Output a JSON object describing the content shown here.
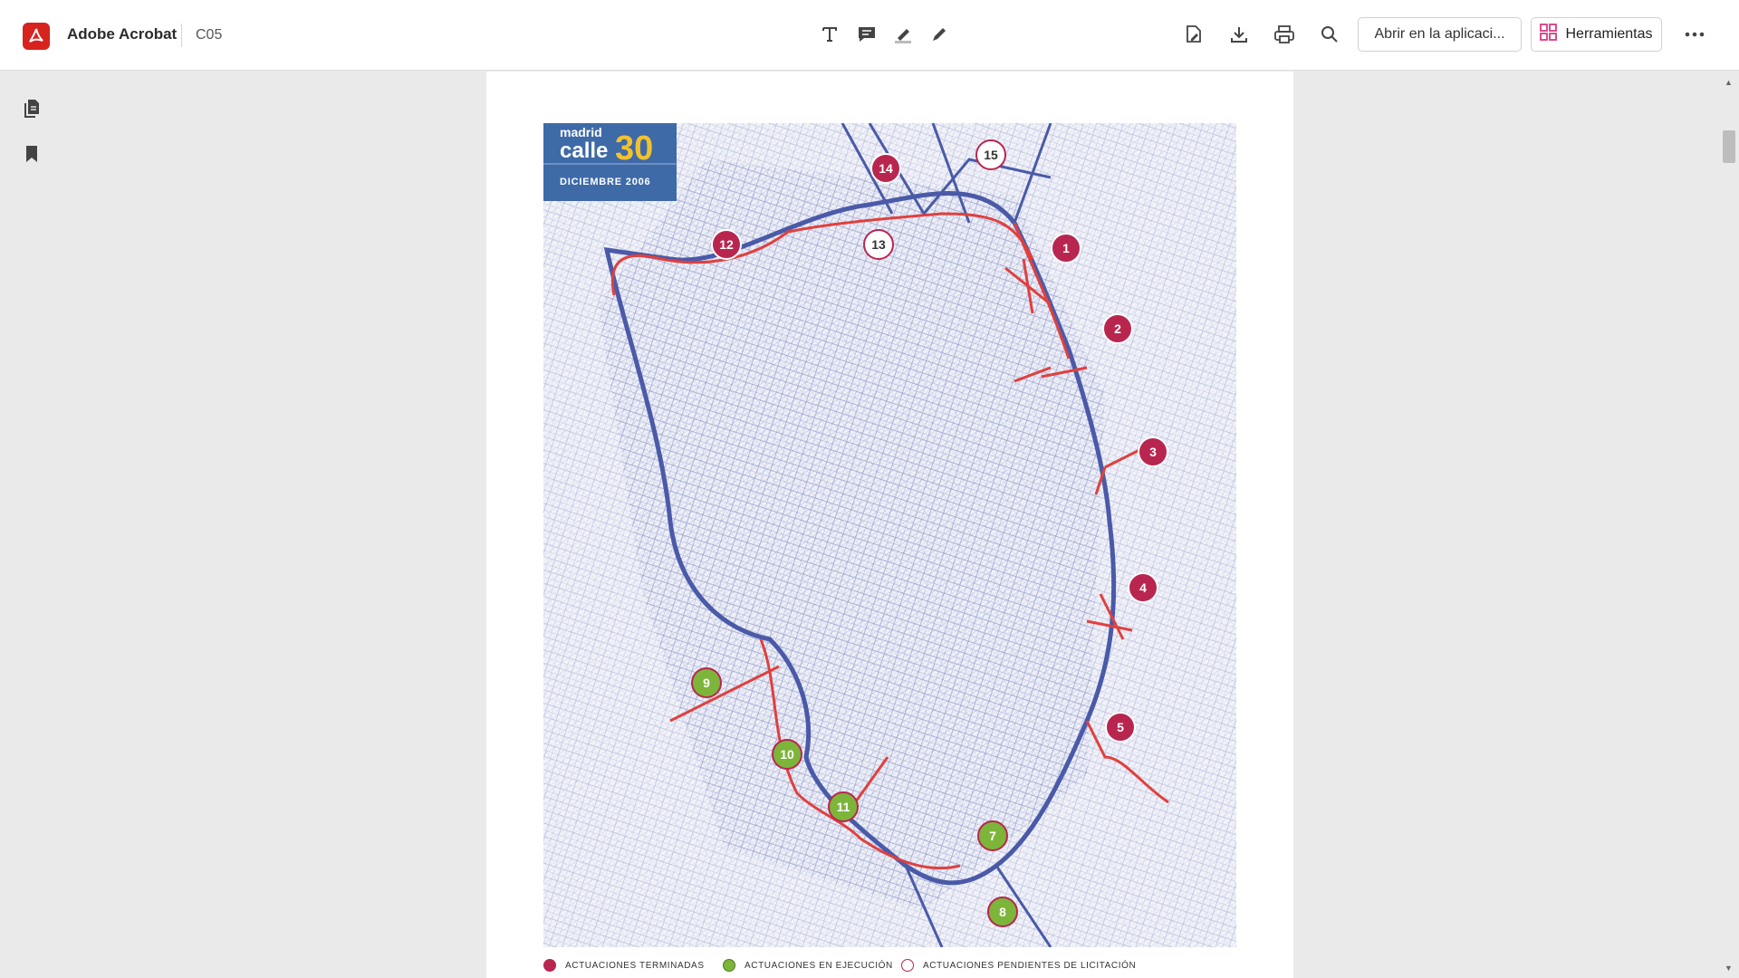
{
  "app": {
    "name": "Adobe Acrobat",
    "document": "C05"
  },
  "toolbar": {
    "tools": [
      "text-tool-icon",
      "comment-icon",
      "highlight-icon",
      "draw-icon"
    ],
    "open_in_app": "Abrir en la aplicaci...",
    "tools_label": "Herramientas"
  },
  "sidebar": {
    "items": [
      "pages-icon",
      "bookmark-icon"
    ]
  },
  "map": {
    "brand_top": "madrid",
    "brand_bottom": "calle",
    "brand_number": "30",
    "date": "DICIEMBRE 2006",
    "markers": [
      {
        "label": "1",
        "status": "terminada"
      },
      {
        "label": "2",
        "status": "terminada"
      },
      {
        "label": "3",
        "status": "terminada"
      },
      {
        "label": "4",
        "status": "terminada"
      },
      {
        "label": "5",
        "status": "terminada"
      },
      {
        "label": "7",
        "status": "ejecucion"
      },
      {
        "label": "8",
        "status": "ejecucion"
      },
      {
        "label": "9",
        "status": "ejecucion"
      },
      {
        "label": "10",
        "status": "ejecucion"
      },
      {
        "label": "11",
        "status": "ejecucion"
      },
      {
        "label": "12",
        "status": "terminada"
      },
      {
        "label": "13",
        "status": "pendiente"
      },
      {
        "label": "14",
        "status": "terminada"
      },
      {
        "label": "15",
        "status": "pendiente"
      }
    ]
  },
  "legend": [
    {
      "label": "ACTUACIONES TERMINADAS",
      "color": "#b8264f"
    },
    {
      "label": "ACTUACIONES EN EJECUCIÓN",
      "color": "#7cb53a"
    },
    {
      "label": "ACTUACIONES PENDIENTES DE LICITACIÓN",
      "color": "#ffffff"
    }
  ],
  "colors": {
    "terminada": "#b8264f",
    "ejecucion": "#7cb53a",
    "pendiente": "#ffffff",
    "acrobat_red": "#d7231e",
    "map_blue": "#4a5aa8",
    "route_red": "#e0403e"
  }
}
